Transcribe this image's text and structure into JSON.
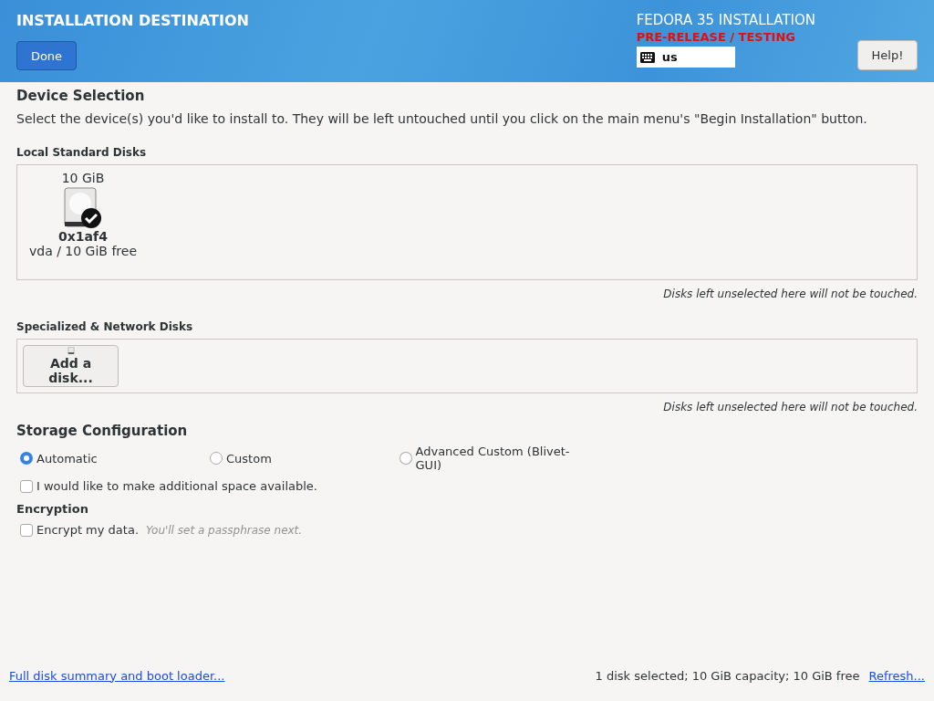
{
  "header": {
    "title": "INSTALLATION DESTINATION",
    "done_button": "Done",
    "product": "FEDORA 35 INSTALLATION",
    "prerelease": "PRE-RELEASE / TESTING",
    "keyboard_layout": "us",
    "help_button": "Help!"
  },
  "device_selection": {
    "heading": "Device Selection",
    "description": "Select the device(s) you'd like to install to.  They will be left untouched until you click on the main menu's \"Begin Installation\" button."
  },
  "local_disks": {
    "heading": "Local Standard Disks",
    "disks": [
      {
        "size": "10 GiB",
        "name": "0x1af4",
        "detail": "vda  /  10 GiB free",
        "selected": true
      }
    ],
    "note": "Disks left unselected here will not be touched."
  },
  "network_disks": {
    "heading": "Specialized & Network Disks",
    "add_button": "Add a disk...",
    "note": "Disks left unselected here will not be touched."
  },
  "storage_configuration": {
    "heading": "Storage Configuration",
    "options": [
      {
        "label": "Automatic",
        "selected": true
      },
      {
        "label": "Custom",
        "selected": false
      },
      {
        "label": "Advanced Custom (Blivet-GUI)",
        "selected": false
      }
    ],
    "additional_space": {
      "label": "I would like to make additional space available.",
      "checked": false
    }
  },
  "encryption": {
    "heading": "Encryption",
    "encrypt": {
      "label": "Encrypt my data.",
      "hint": "You'll set a passphrase next.",
      "checked": false
    }
  },
  "footer": {
    "summary_link": "Full disk summary and boot loader...",
    "status": "1 disk selected; 10 GiB capacity; 10 GiB free",
    "refresh_link": "Refresh..."
  }
}
